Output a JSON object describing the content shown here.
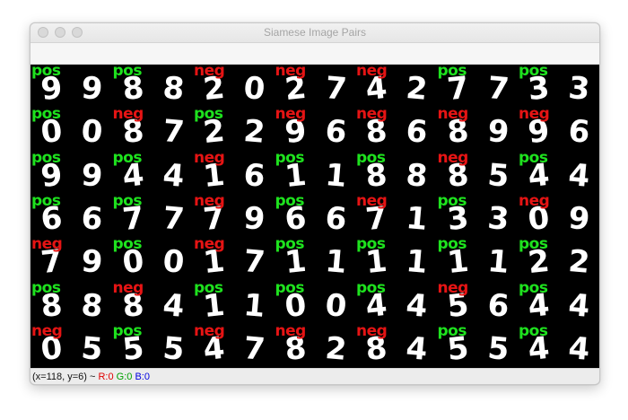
{
  "window": {
    "title": "Siamese Image Pairs"
  },
  "colors": {
    "pos": "#1ee21e",
    "neg": "#e51414"
  },
  "grid": {
    "rows": [
      [
        {
          "label": "pos",
          "d": [
            "9",
            "9"
          ]
        },
        {
          "label": "pos",
          "d": [
            "8",
            "8"
          ]
        },
        {
          "label": "neg",
          "d": [
            "2",
            "0"
          ]
        },
        {
          "label": "neg",
          "d": [
            "2",
            "7"
          ]
        },
        {
          "label": "neg",
          "d": [
            "4",
            "2"
          ]
        },
        {
          "label": "pos",
          "d": [
            "7",
            "7"
          ]
        },
        {
          "label": "pos",
          "d": [
            "3",
            "3"
          ]
        }
      ],
      [
        {
          "label": "pos",
          "d": [
            "0",
            "0"
          ]
        },
        {
          "label": "neg",
          "d": [
            "8",
            "7"
          ]
        },
        {
          "label": "pos",
          "d": [
            "2",
            "2"
          ]
        },
        {
          "label": "neg",
          "d": [
            "9",
            "6"
          ]
        },
        {
          "label": "neg",
          "d": [
            "8",
            "6"
          ]
        },
        {
          "label": "neg",
          "d": [
            "8",
            "9"
          ]
        },
        {
          "label": "neg",
          "d": [
            "9",
            "6"
          ]
        }
      ],
      [
        {
          "label": "pos",
          "d": [
            "9",
            "9"
          ]
        },
        {
          "label": "pos",
          "d": [
            "4",
            "4"
          ]
        },
        {
          "label": "neg",
          "d": [
            "1",
            "6"
          ]
        },
        {
          "label": "pos",
          "d": [
            "1",
            "1"
          ]
        },
        {
          "label": "pos",
          "d": [
            "8",
            "8"
          ]
        },
        {
          "label": "neg",
          "d": [
            "8",
            "5"
          ]
        },
        {
          "label": "pos",
          "d": [
            "4",
            "4"
          ]
        }
      ],
      [
        {
          "label": "pos",
          "d": [
            "6",
            "6"
          ]
        },
        {
          "label": "pos",
          "d": [
            "7",
            "7"
          ]
        },
        {
          "label": "neg",
          "d": [
            "7",
            "9"
          ]
        },
        {
          "label": "pos",
          "d": [
            "6",
            "6"
          ]
        },
        {
          "label": "neg",
          "d": [
            "7",
            "1"
          ]
        },
        {
          "label": "pos",
          "d": [
            "3",
            "3"
          ]
        },
        {
          "label": "neg",
          "d": [
            "0",
            "9"
          ]
        }
      ],
      [
        {
          "label": "neg",
          "d": [
            "7",
            "9"
          ]
        },
        {
          "label": "pos",
          "d": [
            "0",
            "0"
          ]
        },
        {
          "label": "neg",
          "d": [
            "1",
            "7"
          ]
        },
        {
          "label": "pos",
          "d": [
            "1",
            "1"
          ]
        },
        {
          "label": "pos",
          "d": [
            "1",
            "1"
          ]
        },
        {
          "label": "pos",
          "d": [
            "1",
            "1"
          ]
        },
        {
          "label": "pos",
          "d": [
            "2",
            "2"
          ]
        }
      ],
      [
        {
          "label": "pos",
          "d": [
            "8",
            "8"
          ]
        },
        {
          "label": "neg",
          "d": [
            "8",
            "4"
          ]
        },
        {
          "label": "pos",
          "d": [
            "1",
            "1"
          ]
        },
        {
          "label": "pos",
          "d": [
            "0",
            "0"
          ]
        },
        {
          "label": "pos",
          "d": [
            "4",
            "4"
          ]
        },
        {
          "label": "neg",
          "d": [
            "5",
            "6"
          ]
        },
        {
          "label": "pos",
          "d": [
            "4",
            "4"
          ]
        }
      ],
      [
        {
          "label": "neg",
          "d": [
            "0",
            "5"
          ]
        },
        {
          "label": "pos",
          "d": [
            "5",
            "5"
          ]
        },
        {
          "label": "neg",
          "d": [
            "4",
            "7"
          ]
        },
        {
          "label": "neg",
          "d": [
            "8",
            "2"
          ]
        },
        {
          "label": "neg",
          "d": [
            "8",
            "4"
          ]
        },
        {
          "label": "pos",
          "d": [
            "5",
            "5"
          ]
        },
        {
          "label": "pos",
          "d": [
            "4",
            "4"
          ]
        }
      ]
    ]
  },
  "status": {
    "coords": "(x=118, y=6) ~",
    "r": "R:0",
    "g": "G:0",
    "b": "B:0",
    "r_color": "#e00000",
    "g_color": "#00a000",
    "b_color": "#0000e0"
  }
}
